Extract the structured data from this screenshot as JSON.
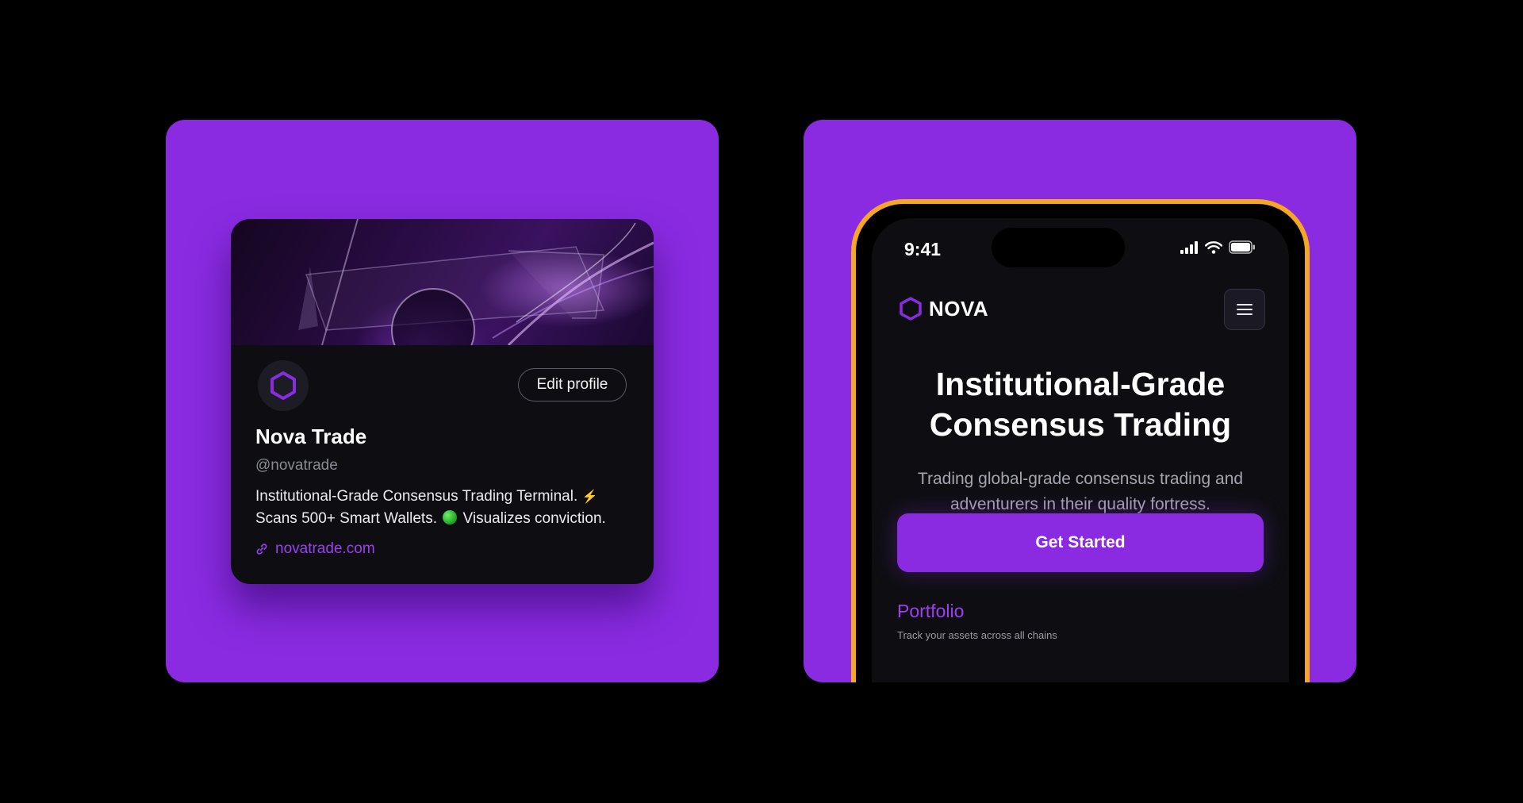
{
  "colors": {
    "background": "#000000",
    "panel": "#8a2be2",
    "accent": "#9b3ff0",
    "phone_frame": "#f5a623",
    "card_bg": "#0d0d12"
  },
  "profile_card": {
    "name": "Nova Trade",
    "handle": "@novatrade",
    "edit_button": "Edit profile",
    "bio_line1": "Institutional-Grade Consensus Trading Terminal.",
    "bio_line2_a": "Scans 500+ Smart Wallets.",
    "bio_line2_b": "Visualizes conviction.",
    "link": "novatrade.com",
    "icons": [
      "hexagon-logo-icon",
      "lightning-emoji-icon",
      "green-circle-emoji-icon",
      "link-icon"
    ]
  },
  "phone": {
    "time": "9:41",
    "brand": "NOVA",
    "hero_title_line1": "Institutional-Grade",
    "hero_title_line2": "Consensus Trading",
    "hero_sub_line1": "Trading global-grade consensus trading and",
    "hero_sub_line2": "adventurers in their quality fortress.",
    "cta": "Get Started",
    "section_title": "Portfolio",
    "section_subtitle": "Track your assets across all chains",
    "icons": [
      "signal-icon",
      "wifi-icon",
      "battery-icon",
      "hexagon-logo-icon",
      "hamburger-menu-icon"
    ]
  }
}
